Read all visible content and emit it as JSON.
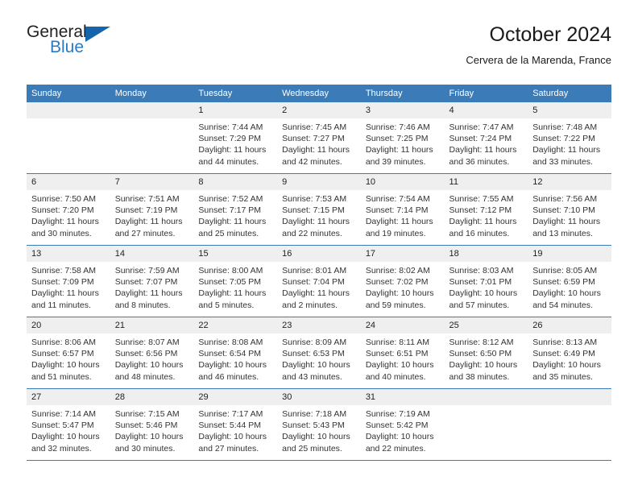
{
  "brand": {
    "name_part1": "General",
    "name_part2": "Blue",
    "triangle_color": "#1565ad",
    "blue_color": "#2a7ac4"
  },
  "header": {
    "title": "October 2024",
    "subtitle": "Cervera de la Marenda, France"
  },
  "theme": {
    "header_blue": "#3b7cb8",
    "daynum_gray": "#efefef",
    "text": "#333333"
  },
  "calendar": {
    "weekday_headers": [
      "Sunday",
      "Monday",
      "Tuesday",
      "Wednesday",
      "Thursday",
      "Friday",
      "Saturday"
    ],
    "weeks": [
      [
        {
          "day": "",
          "sunrise": "",
          "sunset": "",
          "daylight_line1": "",
          "daylight_line2": ""
        },
        {
          "day": "",
          "sunrise": "",
          "sunset": "",
          "daylight_line1": "",
          "daylight_line2": ""
        },
        {
          "day": "1",
          "sunrise": "Sunrise: 7:44 AM",
          "sunset": "Sunset: 7:29 PM",
          "daylight_line1": "Daylight: 11 hours",
          "daylight_line2": "and 44 minutes."
        },
        {
          "day": "2",
          "sunrise": "Sunrise: 7:45 AM",
          "sunset": "Sunset: 7:27 PM",
          "daylight_line1": "Daylight: 11 hours",
          "daylight_line2": "and 42 minutes."
        },
        {
          "day": "3",
          "sunrise": "Sunrise: 7:46 AM",
          "sunset": "Sunset: 7:25 PM",
          "daylight_line1": "Daylight: 11 hours",
          "daylight_line2": "and 39 minutes."
        },
        {
          "day": "4",
          "sunrise": "Sunrise: 7:47 AM",
          "sunset": "Sunset: 7:24 PM",
          "daylight_line1": "Daylight: 11 hours",
          "daylight_line2": "and 36 minutes."
        },
        {
          "day": "5",
          "sunrise": "Sunrise: 7:48 AM",
          "sunset": "Sunset: 7:22 PM",
          "daylight_line1": "Daylight: 11 hours",
          "daylight_line2": "and 33 minutes."
        }
      ],
      [
        {
          "day": "6",
          "sunrise": "Sunrise: 7:50 AM",
          "sunset": "Sunset: 7:20 PM",
          "daylight_line1": "Daylight: 11 hours",
          "daylight_line2": "and 30 minutes."
        },
        {
          "day": "7",
          "sunrise": "Sunrise: 7:51 AM",
          "sunset": "Sunset: 7:19 PM",
          "daylight_line1": "Daylight: 11 hours",
          "daylight_line2": "and 27 minutes."
        },
        {
          "day": "8",
          "sunrise": "Sunrise: 7:52 AM",
          "sunset": "Sunset: 7:17 PM",
          "daylight_line1": "Daylight: 11 hours",
          "daylight_line2": "and 25 minutes."
        },
        {
          "day": "9",
          "sunrise": "Sunrise: 7:53 AM",
          "sunset": "Sunset: 7:15 PM",
          "daylight_line1": "Daylight: 11 hours",
          "daylight_line2": "and 22 minutes."
        },
        {
          "day": "10",
          "sunrise": "Sunrise: 7:54 AM",
          "sunset": "Sunset: 7:14 PM",
          "daylight_line1": "Daylight: 11 hours",
          "daylight_line2": "and 19 minutes."
        },
        {
          "day": "11",
          "sunrise": "Sunrise: 7:55 AM",
          "sunset": "Sunset: 7:12 PM",
          "daylight_line1": "Daylight: 11 hours",
          "daylight_line2": "and 16 minutes."
        },
        {
          "day": "12",
          "sunrise": "Sunrise: 7:56 AM",
          "sunset": "Sunset: 7:10 PM",
          "daylight_line1": "Daylight: 11 hours",
          "daylight_line2": "and 13 minutes."
        }
      ],
      [
        {
          "day": "13",
          "sunrise": "Sunrise: 7:58 AM",
          "sunset": "Sunset: 7:09 PM",
          "daylight_line1": "Daylight: 11 hours",
          "daylight_line2": "and 11 minutes."
        },
        {
          "day": "14",
          "sunrise": "Sunrise: 7:59 AM",
          "sunset": "Sunset: 7:07 PM",
          "daylight_line1": "Daylight: 11 hours",
          "daylight_line2": "and 8 minutes."
        },
        {
          "day": "15",
          "sunrise": "Sunrise: 8:00 AM",
          "sunset": "Sunset: 7:05 PM",
          "daylight_line1": "Daylight: 11 hours",
          "daylight_line2": "and 5 minutes."
        },
        {
          "day": "16",
          "sunrise": "Sunrise: 8:01 AM",
          "sunset": "Sunset: 7:04 PM",
          "daylight_line1": "Daylight: 11 hours",
          "daylight_line2": "and 2 minutes."
        },
        {
          "day": "17",
          "sunrise": "Sunrise: 8:02 AM",
          "sunset": "Sunset: 7:02 PM",
          "daylight_line1": "Daylight: 10 hours",
          "daylight_line2": "and 59 minutes."
        },
        {
          "day": "18",
          "sunrise": "Sunrise: 8:03 AM",
          "sunset": "Sunset: 7:01 PM",
          "daylight_line1": "Daylight: 10 hours",
          "daylight_line2": "and 57 minutes."
        },
        {
          "day": "19",
          "sunrise": "Sunrise: 8:05 AM",
          "sunset": "Sunset: 6:59 PM",
          "daylight_line1": "Daylight: 10 hours",
          "daylight_line2": "and 54 minutes."
        }
      ],
      [
        {
          "day": "20",
          "sunrise": "Sunrise: 8:06 AM",
          "sunset": "Sunset: 6:57 PM",
          "daylight_line1": "Daylight: 10 hours",
          "daylight_line2": "and 51 minutes."
        },
        {
          "day": "21",
          "sunrise": "Sunrise: 8:07 AM",
          "sunset": "Sunset: 6:56 PM",
          "daylight_line1": "Daylight: 10 hours",
          "daylight_line2": "and 48 minutes."
        },
        {
          "day": "22",
          "sunrise": "Sunrise: 8:08 AM",
          "sunset": "Sunset: 6:54 PM",
          "daylight_line1": "Daylight: 10 hours",
          "daylight_line2": "and 46 minutes."
        },
        {
          "day": "23",
          "sunrise": "Sunrise: 8:09 AM",
          "sunset": "Sunset: 6:53 PM",
          "daylight_line1": "Daylight: 10 hours",
          "daylight_line2": "and 43 minutes."
        },
        {
          "day": "24",
          "sunrise": "Sunrise: 8:11 AM",
          "sunset": "Sunset: 6:51 PM",
          "daylight_line1": "Daylight: 10 hours",
          "daylight_line2": "and 40 minutes."
        },
        {
          "day": "25",
          "sunrise": "Sunrise: 8:12 AM",
          "sunset": "Sunset: 6:50 PM",
          "daylight_line1": "Daylight: 10 hours",
          "daylight_line2": "and 38 minutes."
        },
        {
          "day": "26",
          "sunrise": "Sunrise: 8:13 AM",
          "sunset": "Sunset: 6:49 PM",
          "daylight_line1": "Daylight: 10 hours",
          "daylight_line2": "and 35 minutes."
        }
      ],
      [
        {
          "day": "27",
          "sunrise": "Sunrise: 7:14 AM",
          "sunset": "Sunset: 5:47 PM",
          "daylight_line1": "Daylight: 10 hours",
          "daylight_line2": "and 32 minutes."
        },
        {
          "day": "28",
          "sunrise": "Sunrise: 7:15 AM",
          "sunset": "Sunset: 5:46 PM",
          "daylight_line1": "Daylight: 10 hours",
          "daylight_line2": "and 30 minutes."
        },
        {
          "day": "29",
          "sunrise": "Sunrise: 7:17 AM",
          "sunset": "Sunset: 5:44 PM",
          "daylight_line1": "Daylight: 10 hours",
          "daylight_line2": "and 27 minutes."
        },
        {
          "day": "30",
          "sunrise": "Sunrise: 7:18 AM",
          "sunset": "Sunset: 5:43 PM",
          "daylight_line1": "Daylight: 10 hours",
          "daylight_line2": "and 25 minutes."
        },
        {
          "day": "31",
          "sunrise": "Sunrise: 7:19 AM",
          "sunset": "Sunset: 5:42 PM",
          "daylight_line1": "Daylight: 10 hours",
          "daylight_line2": "and 22 minutes."
        },
        {
          "day": "",
          "sunrise": "",
          "sunset": "",
          "daylight_line1": "",
          "daylight_line2": ""
        },
        {
          "day": "",
          "sunrise": "",
          "sunset": "",
          "daylight_line1": "",
          "daylight_line2": ""
        }
      ]
    ]
  }
}
